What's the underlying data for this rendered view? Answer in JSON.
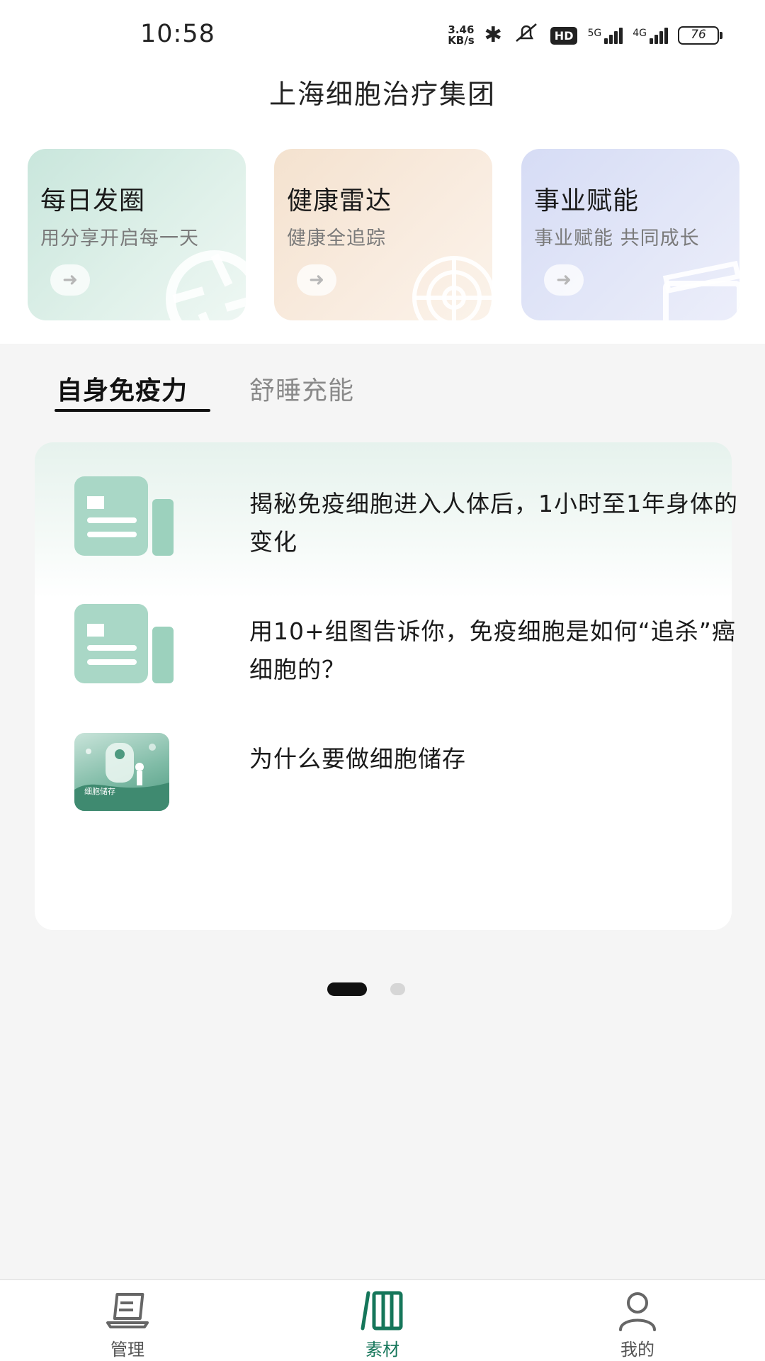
{
  "status_bar": {
    "time": "10:58",
    "net_speed_value": "3.46",
    "net_speed_unit": "KB/s",
    "hd_label": "HD",
    "network_1": "5G",
    "network_2": "4G",
    "battery": "76",
    "icons": [
      "bluetooth-icon",
      "mute-icon",
      "signal-icon",
      "battery-icon"
    ]
  },
  "app": {
    "title": "上海细胞治疗集团"
  },
  "feature_cards": [
    {
      "title": "每日发圈",
      "subtitle": "用分享开启每一天",
      "color": "#d5ece3",
      "icon": "aperture-icon"
    },
    {
      "title": "健康雷达",
      "subtitle": "健康全追踪",
      "color": "#f6e6d6",
      "icon": "radar-icon"
    },
    {
      "title": "事业赋能",
      "subtitle": "事业赋能 共同成长",
      "color": "#dde2f7",
      "icon": "clapperboard-icon"
    }
  ],
  "tabs": [
    {
      "label": "自身免疫力",
      "active": true
    },
    {
      "label": "舒睡充能",
      "active": false
    }
  ],
  "articles": [
    {
      "title": "揭秘免疫细胞进入人体后，1小时至1年身体的变化",
      "thumbnail": "document-icon"
    },
    {
      "title": "用10+组图告诉你，免疫细胞是如何“追杀”癌细胞的？",
      "thumbnail": "document-icon"
    },
    {
      "title": "为什么要做细胞储存",
      "thumbnail": "image",
      "thumbnail_text": "细胞储存"
    }
  ],
  "pager": {
    "total": 2,
    "current": 1
  },
  "bottom_nav": [
    {
      "label": "管理",
      "icon": "laptop-icon",
      "active": false
    },
    {
      "label": "素材",
      "icon": "library-icon",
      "active": true
    },
    {
      "label": "我的",
      "icon": "person-icon",
      "active": false
    }
  ],
  "colors": {
    "accent": "#15765a",
    "text": "#1a1a1a",
    "muted": "#7a7a7a",
    "background": "#f5f5f5"
  }
}
